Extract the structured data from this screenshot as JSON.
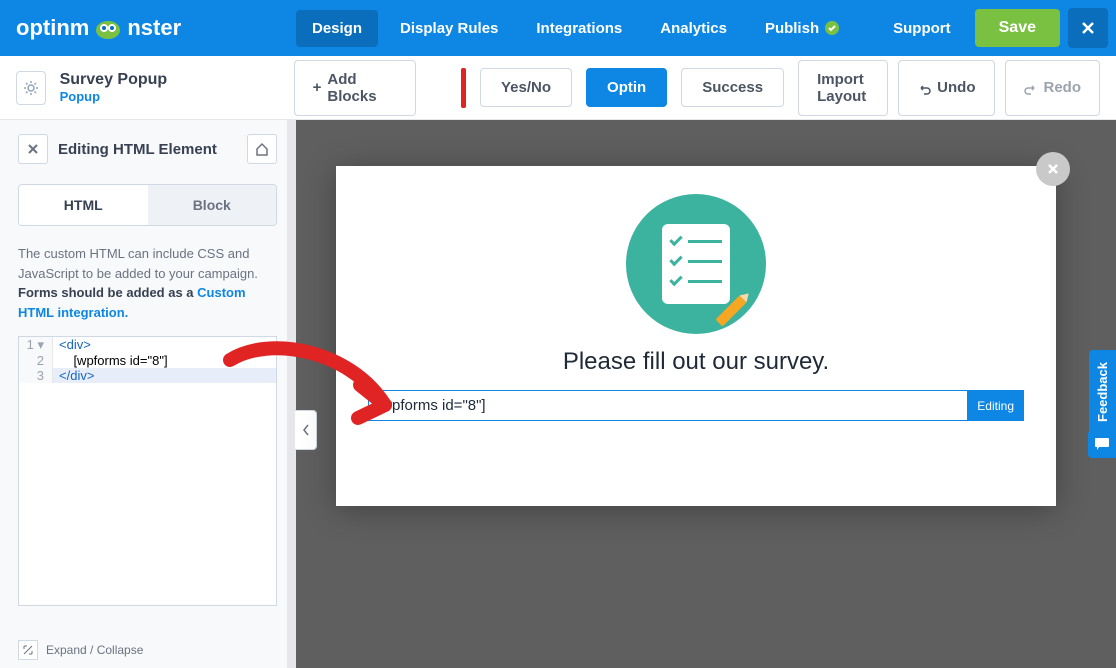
{
  "brand": "optinmonster",
  "nav": {
    "design": "Design",
    "display_rules": "Display Rules",
    "integrations": "Integrations",
    "analytics": "Analytics",
    "publish": "Publish",
    "support": "Support",
    "save": "Save"
  },
  "campaign": {
    "title": "Survey Popup",
    "type": "Popup"
  },
  "toolbar": {
    "add_blocks": "Add Blocks",
    "yes_no": "Yes/No",
    "optin": "Optin",
    "success": "Success",
    "import": "Import Layout",
    "undo": "Undo",
    "redo": "Redo"
  },
  "sidebar": {
    "title": "Editing HTML Element",
    "tabs": {
      "html": "HTML",
      "block": "Block"
    },
    "help_pre": "The custom HTML can include CSS and JavaScript to be added to your campaign. ",
    "help_bold": "Forms should be added as a ",
    "help_link": "Custom HTML integration.",
    "code": {
      "l1_open": "<",
      "l1_tag": "div",
      "l1_close": ">",
      "l2": "    [wpforms id=\"8\"]",
      "l3_open": "</",
      "l3_tag": "div",
      "l3_close": ">"
    },
    "lines": {
      "n1": "1",
      "n2": "2",
      "n3": "3"
    },
    "expand": "Expand / Collapse"
  },
  "popup": {
    "title": "Please fill out our survey.",
    "shortcode": "[wpforms id=\"8\"]",
    "editing": "Editing"
  },
  "feedback": "Feedback"
}
